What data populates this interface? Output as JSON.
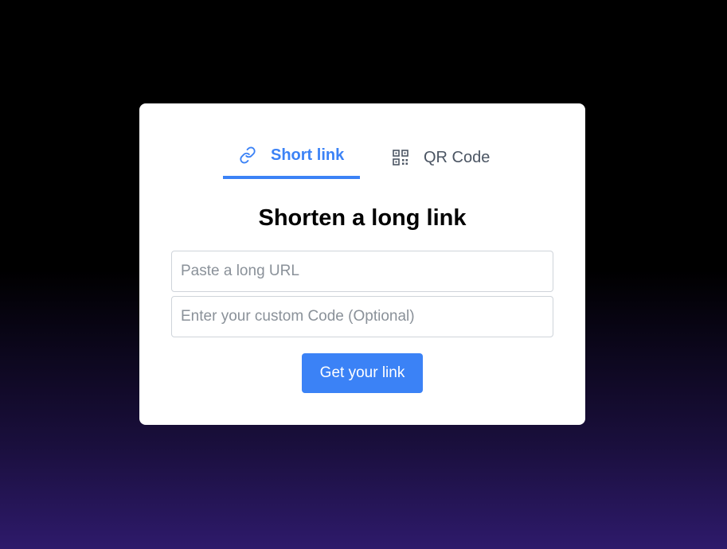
{
  "tabs": [
    {
      "label": "Short link",
      "icon": "link-icon",
      "active": true
    },
    {
      "label": "QR Code",
      "icon": "qr-code-icon",
      "active": false
    }
  ],
  "form": {
    "title": "Shorten a long link",
    "url_placeholder": "Paste a long URL",
    "url_value": "",
    "code_placeholder": "Enter your custom Code (Optional)",
    "code_value": "",
    "submit_label": "Get your link"
  },
  "colors": {
    "accent": "#3b82f6",
    "background_top": "#000000",
    "background_bottom": "#2e1a6b",
    "card": "#ffffff"
  }
}
